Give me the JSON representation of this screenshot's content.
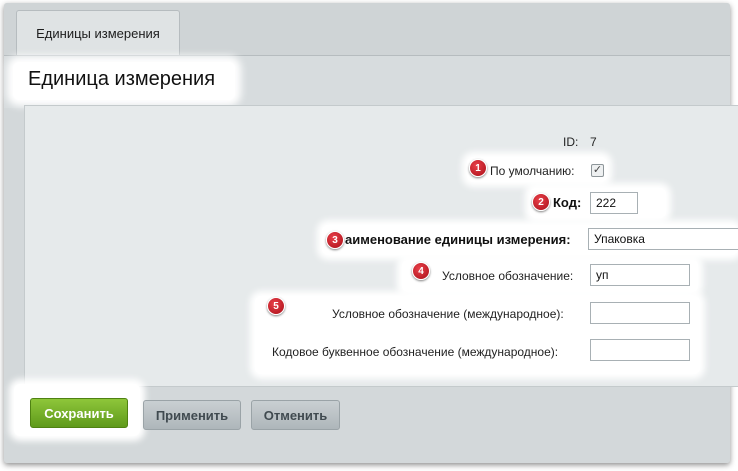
{
  "tabs": [
    {
      "label": "Единицы измерения"
    }
  ],
  "page_title": "Единица измерения",
  "form": {
    "id_label": "ID:",
    "id_value": "7",
    "default_label": "По умолчанию:",
    "default_checked": true,
    "code_label": "Код:",
    "code_value": "222",
    "name_label": "аименование единицы измерения:",
    "name_value": "Упаковка",
    "symbol_label": "Условное обозначение:",
    "symbol_value": "уп",
    "symbol_intl_label": "Условное обозначение (международное):",
    "symbol_intl_value": "",
    "letter_code_intl_label": "Кодовое буквенное обозначение (международное):",
    "letter_code_intl_value": ""
  },
  "badges": [
    "1",
    "2",
    "3",
    "4",
    "5"
  ],
  "buttons": {
    "save": "Сохранить",
    "apply": "Применить",
    "cancel": "Отменить"
  },
  "colors": {
    "save_button": "#6fae25",
    "badge": "#c8151f"
  }
}
